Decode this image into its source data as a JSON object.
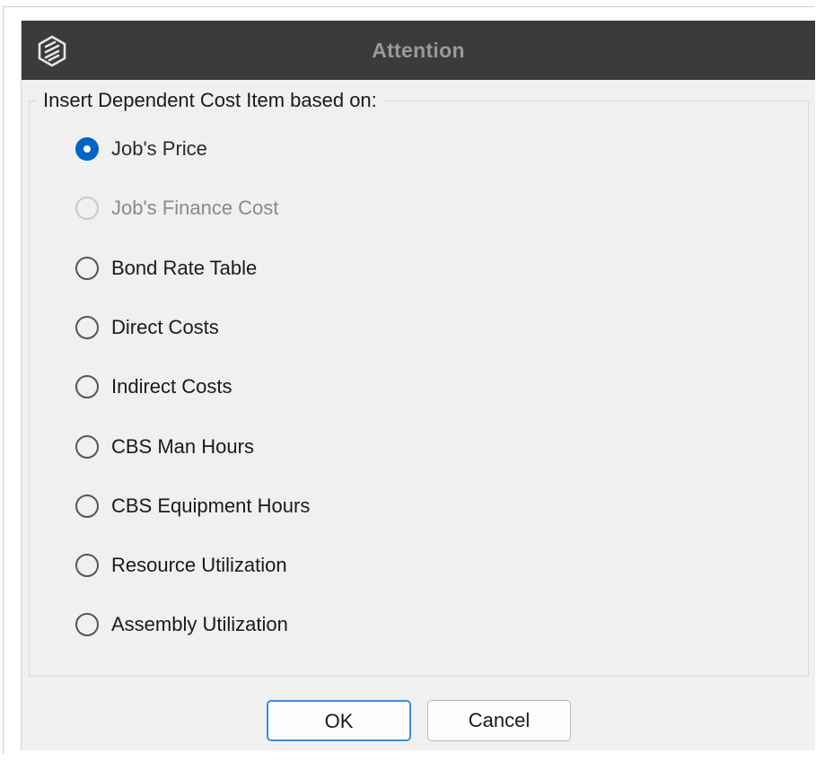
{
  "dialog": {
    "title": "Attention",
    "icon": "app-logo-icon"
  },
  "group": {
    "legend": "Insert Dependent Cost Item based on:"
  },
  "options": [
    {
      "label": "Job's Price",
      "state": "checked"
    },
    {
      "label": "Job's Finance Cost",
      "state": "disabled"
    },
    {
      "label": "Bond Rate Table",
      "state": "unchecked"
    },
    {
      "label": "Direct Costs",
      "state": "unchecked"
    },
    {
      "label": "Indirect Costs",
      "state": "unchecked"
    },
    {
      "label": "CBS Man Hours",
      "state": "unchecked"
    },
    {
      "label": "CBS Equipment Hours",
      "state": "unchecked"
    },
    {
      "label": "Resource Utilization",
      "state": "unchecked"
    },
    {
      "label": "Assembly Utilization",
      "state": "unchecked"
    }
  ],
  "buttons": {
    "ok_label": "OK",
    "cancel_label": "Cancel"
  },
  "colors": {
    "titlebar": "#3b3b3b",
    "accent": "#0064c8",
    "ok_border": "#3f8fd6"
  }
}
